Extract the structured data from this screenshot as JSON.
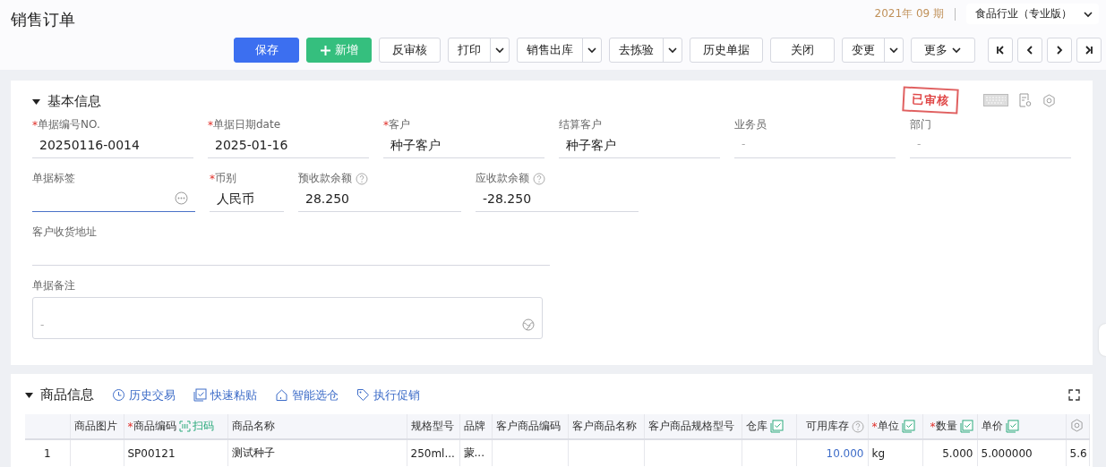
{
  "header": {
    "title": "销售订单",
    "period": "2021年 09 期",
    "edition": "食品行业（专业版）"
  },
  "toolbar": [
    {
      "kind": "primary",
      "label": "保存"
    },
    {
      "kind": "add",
      "label": "新增"
    },
    {
      "kind": "plain",
      "label": "反审核"
    },
    {
      "kind": "split",
      "label": "打印"
    },
    {
      "kind": "split",
      "label": "销售出库"
    },
    {
      "kind": "split",
      "label": "去拣验"
    },
    {
      "kind": "plain",
      "label": "历史单据"
    },
    {
      "kind": "wide",
      "label": "关闭"
    },
    {
      "kind": "split",
      "label": "变更"
    },
    {
      "kind": "menu",
      "label": "更多"
    }
  ],
  "nav_buttons": [
    {
      "kind": "first"
    },
    {
      "kind": "prev"
    },
    {
      "kind": "next"
    },
    {
      "kind": "last"
    }
  ],
  "basic_info": {
    "title": "基本信息",
    "expanded": true,
    "status": "已审核",
    "rows": [
      [
        {
          "marker": "*",
          "label": "单据编号NO.",
          "value": "20250116-0014",
          "help": false,
          "focused": false,
          "kind": "text"
        },
        {
          "marker": "*",
          "label": "单据日期date",
          "value": "2025-01-16",
          "help": false,
          "focused": false,
          "kind": "text"
        },
        {
          "marker": "*",
          "label": "客户",
          "value": "种子客户",
          "help": false,
          "focused": false,
          "kind": "text"
        },
        {
          "label": "结算客户",
          "value": "种子客户",
          "help": false,
          "focused": false,
          "kind": "text"
        },
        {
          "label": "业务员",
          "placeholder": "-",
          "help": false,
          "focused": false,
          "kind": "text"
        },
        {
          "label": "部门",
          "placeholder": "-",
          "help": false,
          "focused": false,
          "kind": "text"
        }
      ],
      [
        {
          "label": "单据标签",
          "help": false,
          "focused": true,
          "kind": "picker"
        },
        {
          "marker": "*",
          "label": "币别",
          "value": "人民币",
          "help": false,
          "focused": false,
          "kind": "short"
        },
        {
          "label": "预收款余额",
          "value": "28.250",
          "help": true,
          "focused": false,
          "kind": "text"
        },
        {
          "label": "应收款余额",
          "value": "-28.250",
          "help": true,
          "focused": false,
          "kind": "text"
        }
      ],
      [
        {
          "label": "客户收货地址",
          "help": false,
          "focused": false,
          "kind": "long"
        }
      ],
      [
        {
          "label": "单据备注",
          "placeholder": "-",
          "help": false,
          "focused": false,
          "kind": "textarea"
        }
      ]
    ]
  },
  "goods": {
    "title": "商品信息",
    "expanded": true,
    "actions": [
      {
        "kind": "history",
        "label": "历史交易"
      },
      {
        "kind": "paste",
        "label": "快速粘贴"
      },
      {
        "kind": "warehouse",
        "label": "智能选仓"
      },
      {
        "kind": "promo",
        "label": "执行促销"
      }
    ],
    "columns": [
      {
        "kind": "index",
        "batch": false,
        "help": false
      },
      {
        "kind": "text",
        "label": "商品图片",
        "batch": false,
        "help": false
      },
      {
        "kind": "text",
        "marker": "*",
        "label": "商品编码",
        "batch": false,
        "help": false,
        "scan_label": "扫码"
      },
      {
        "kind": "text",
        "label": "商品名称",
        "batch": false,
        "help": false
      },
      {
        "kind": "text",
        "label": "规格型号",
        "batch": false,
        "help": false
      },
      {
        "kind": "text",
        "label": "品牌",
        "batch": false,
        "help": false
      },
      {
        "kind": "text",
        "label": "客户商品编码",
        "batch": false,
        "help": false
      },
      {
        "kind": "text",
        "label": "客户商品名称",
        "batch": false,
        "help": false
      },
      {
        "kind": "text",
        "label": "客户商品规格型号",
        "batch": false,
        "help": false
      },
      {
        "kind": "text",
        "label": "仓库",
        "batch": true,
        "help": false
      },
      {
        "kind": "stock",
        "label": "可用库存",
        "batch": false,
        "help": true
      },
      {
        "kind": "text",
        "marker": "*",
        "label": "单位",
        "batch": true,
        "help": false
      },
      {
        "kind": "number",
        "marker": "*",
        "label": "数量",
        "batch": true,
        "help": false
      },
      {
        "kind": "text",
        "label": "单价",
        "batch": true,
        "help": false
      },
      {
        "kind": "settings",
        "batch": false,
        "help": false
      }
    ],
    "rows": [
      [
        "1",
        "",
        "SP00121",
        "测试种子",
        "250ml...",
        "蒙...",
        "",
        "",
        "",
        "",
        "10.000",
        "kg",
        "5.000",
        "5.000000",
        "5.6"
      ]
    ]
  }
}
